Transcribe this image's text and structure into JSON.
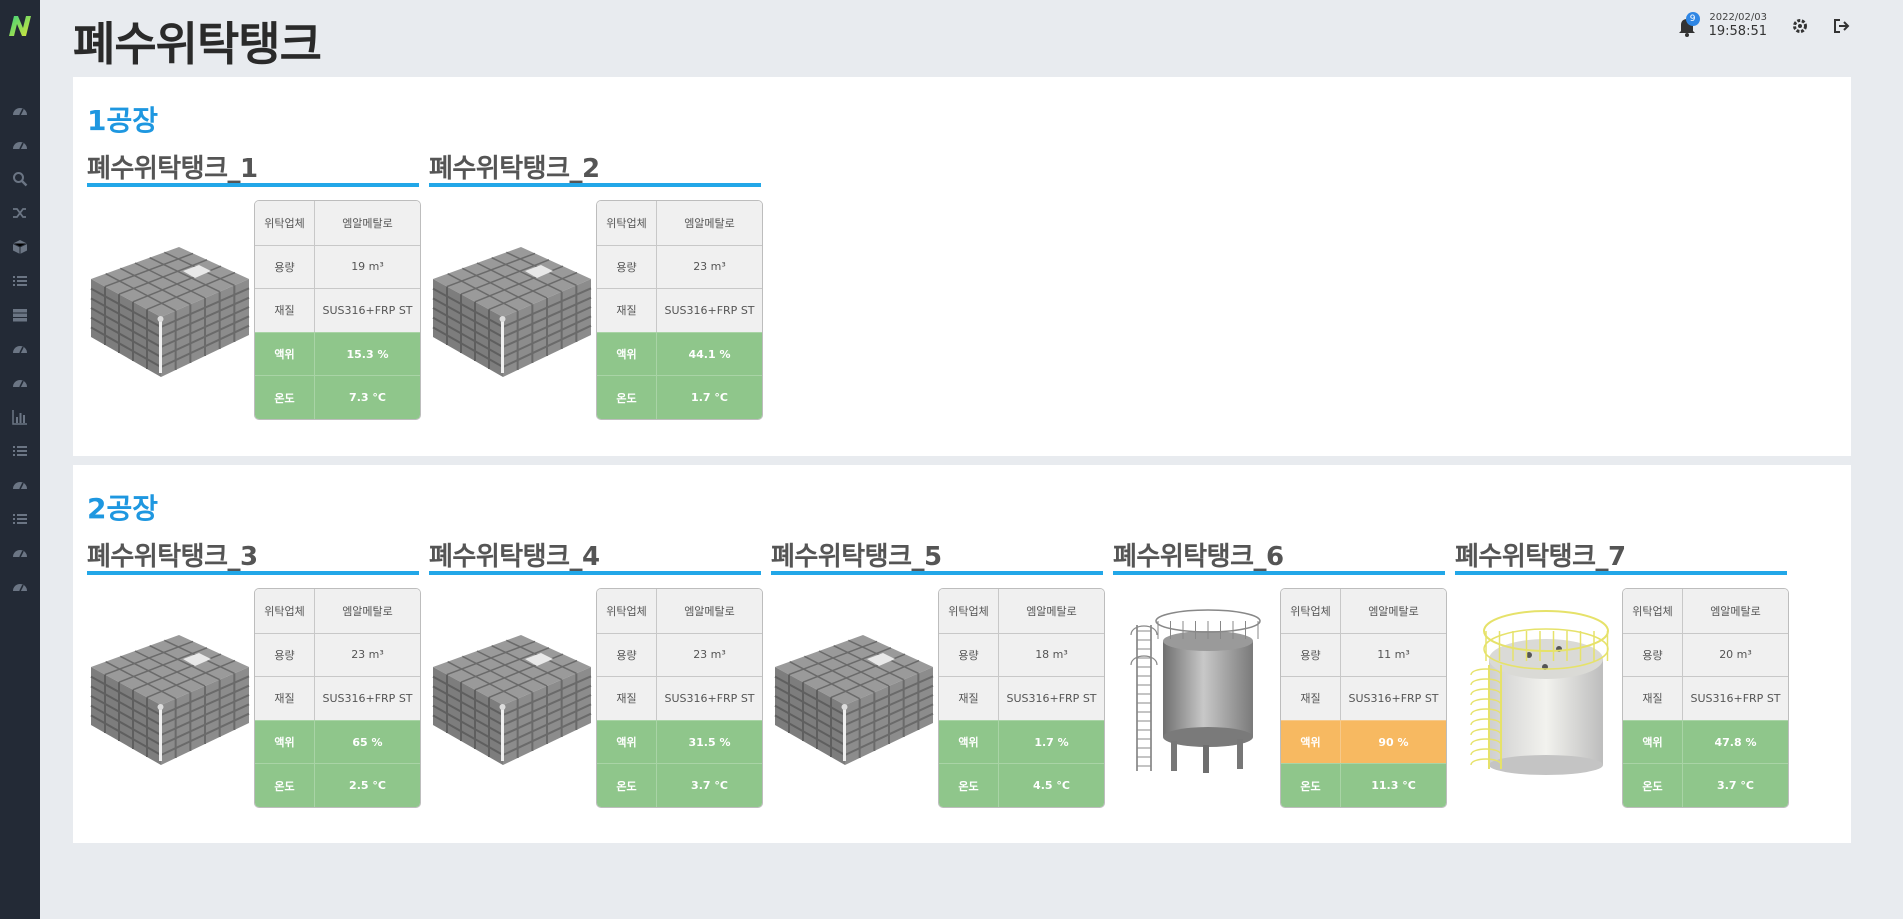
{
  "app": {
    "title": "폐수위탁탱크"
  },
  "header": {
    "notification_count": "9",
    "date": "2022/02/03",
    "time": "19:58:51"
  },
  "sidebar": {
    "icons": [
      "dashboard-icon",
      "dashboard-icon",
      "search-icon",
      "shuffle-icon",
      "cube-icon",
      "list-icon",
      "server-icon",
      "dashboard-icon",
      "dashboard-icon",
      "bar-chart-icon",
      "list-icon",
      "dashboard-icon",
      "list-icon",
      "dashboard-icon",
      "dashboard-icon"
    ]
  },
  "labels": {
    "company": "위탁업체",
    "capacity": "용량",
    "material": "재질",
    "level": "액위",
    "temp": "온도"
  },
  "colors": {
    "accent": "#1e97e0",
    "ok": "#8fc68b",
    "warn": "#f7b961",
    "sidebar": "#232a36"
  },
  "factories": [
    {
      "name": "1공장",
      "tanks": [
        {
          "name": "폐수위탁탱크_1",
          "type": "box",
          "company": "엠알메탈로",
          "capacity": "19 m³",
          "material": "SUS316+FRP ST",
          "level": "15.3 %",
          "level_status": "ok",
          "temp": "7.3 °C"
        },
        {
          "name": "폐수위탁탱크_2",
          "type": "box",
          "company": "엠알메탈로",
          "capacity": "23 m³",
          "material": "SUS316+FRP ST",
          "level": "44.1 %",
          "level_status": "ok",
          "temp": "1.7 °C"
        }
      ]
    },
    {
      "name": "2공장",
      "tanks": [
        {
          "name": "폐수위탁탱크_3",
          "type": "box",
          "company": "엠알메탈로",
          "capacity": "23 m³",
          "material": "SUS316+FRP ST",
          "level": "65 %",
          "level_status": "ok",
          "temp": "2.5 °C"
        },
        {
          "name": "폐수위탁탱크_4",
          "type": "box",
          "company": "엠알메탈로",
          "capacity": "23 m³",
          "material": "SUS316+FRP ST",
          "level": "31.5 %",
          "level_status": "ok",
          "temp": "3.7 °C"
        },
        {
          "name": "폐수위탁탱크_5",
          "type": "box",
          "company": "엠알메탈로",
          "capacity": "18 m³",
          "material": "SUS316+FRP ST",
          "level": "1.7 %",
          "level_status": "ok",
          "temp": "4.5 °C"
        },
        {
          "name": "폐수위탁탱크_6",
          "type": "steel-cylinder",
          "company": "엠알메탈로",
          "capacity": "11 m³",
          "material": "SUS316+FRP ST",
          "level": "90 %",
          "level_status": "warn",
          "temp": "11.3 °C"
        },
        {
          "name": "폐수위탁탱크_7",
          "type": "white-cylinder",
          "company": "엠알메탈로",
          "capacity": "20 m³",
          "material": "SUS316+FRP ST",
          "level": "47.8 %",
          "level_status": "ok",
          "temp": "3.7 °C"
        }
      ]
    }
  ]
}
